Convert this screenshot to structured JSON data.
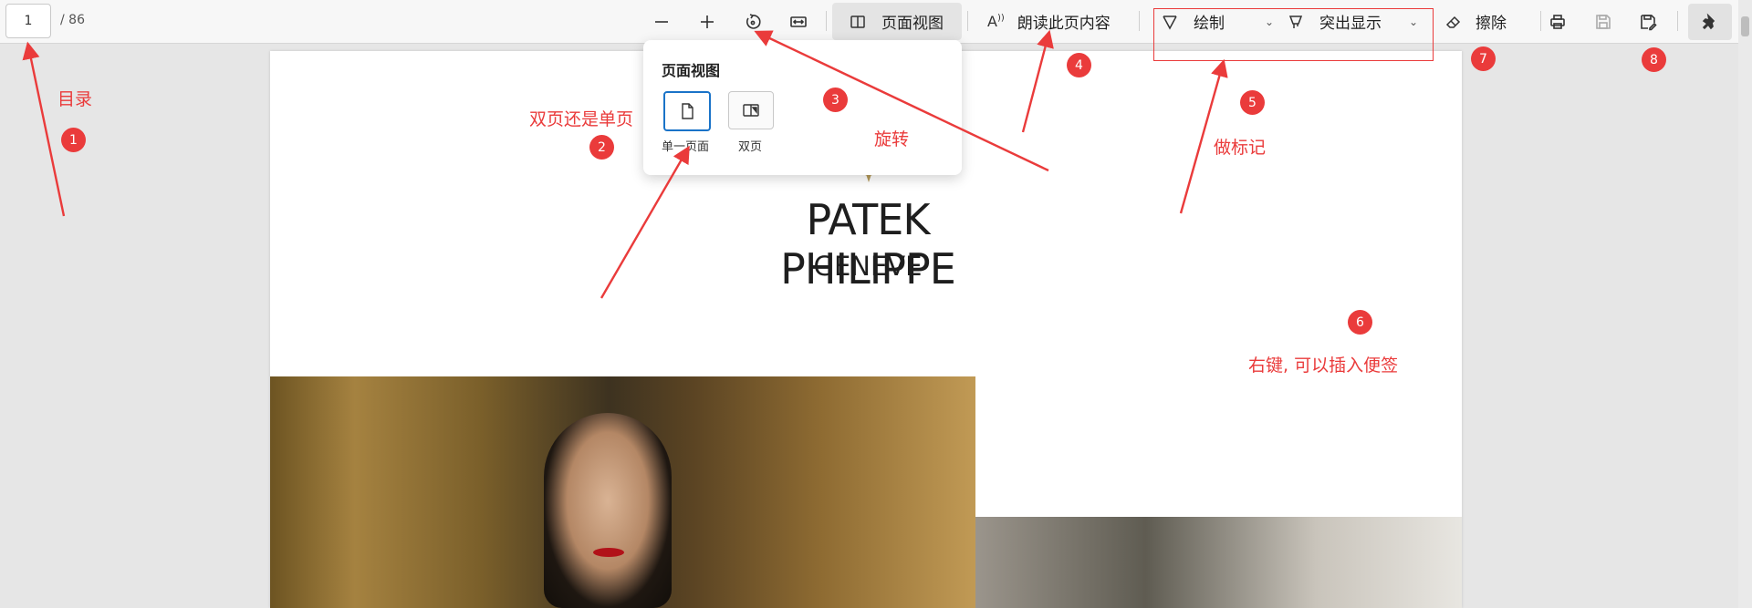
{
  "toolbar": {
    "page_current": "1",
    "page_total": "/ 86",
    "page_view_label": "页面视图",
    "read_aloud_label": "朗读此页内容",
    "draw_label": "绘制",
    "highlight_label": "突出显示",
    "erase_label": "擦除",
    "icons": [
      "zoom-out-icon",
      "zoom-in-icon",
      "rotate-icon",
      "fit-width-icon",
      "page-view-icon",
      "read-aloud-icon",
      "draw-icon",
      "highlight-icon",
      "eraser-icon",
      "print-icon",
      "save-icon",
      "save-as-icon",
      "pin-icon"
    ]
  },
  "popup": {
    "title": "页面视图",
    "options": [
      {
        "label": "单一页面",
        "selected": true
      },
      {
        "label": "双页",
        "selected": false
      }
    ]
  },
  "document": {
    "logo_title": "PATEK PHILIPPE",
    "logo_subtitle": "GENEVE"
  },
  "annotations": {
    "toc": "目录",
    "double_or_single": "双页还是单页",
    "rotate": "旋转",
    "mark": "做标记",
    "right_click_note": "右键, 可以插入便签",
    "badges": [
      "1",
      "2",
      "3",
      "4",
      "5",
      "6",
      "7",
      "8"
    ],
    "color": "#ea3b3b"
  }
}
